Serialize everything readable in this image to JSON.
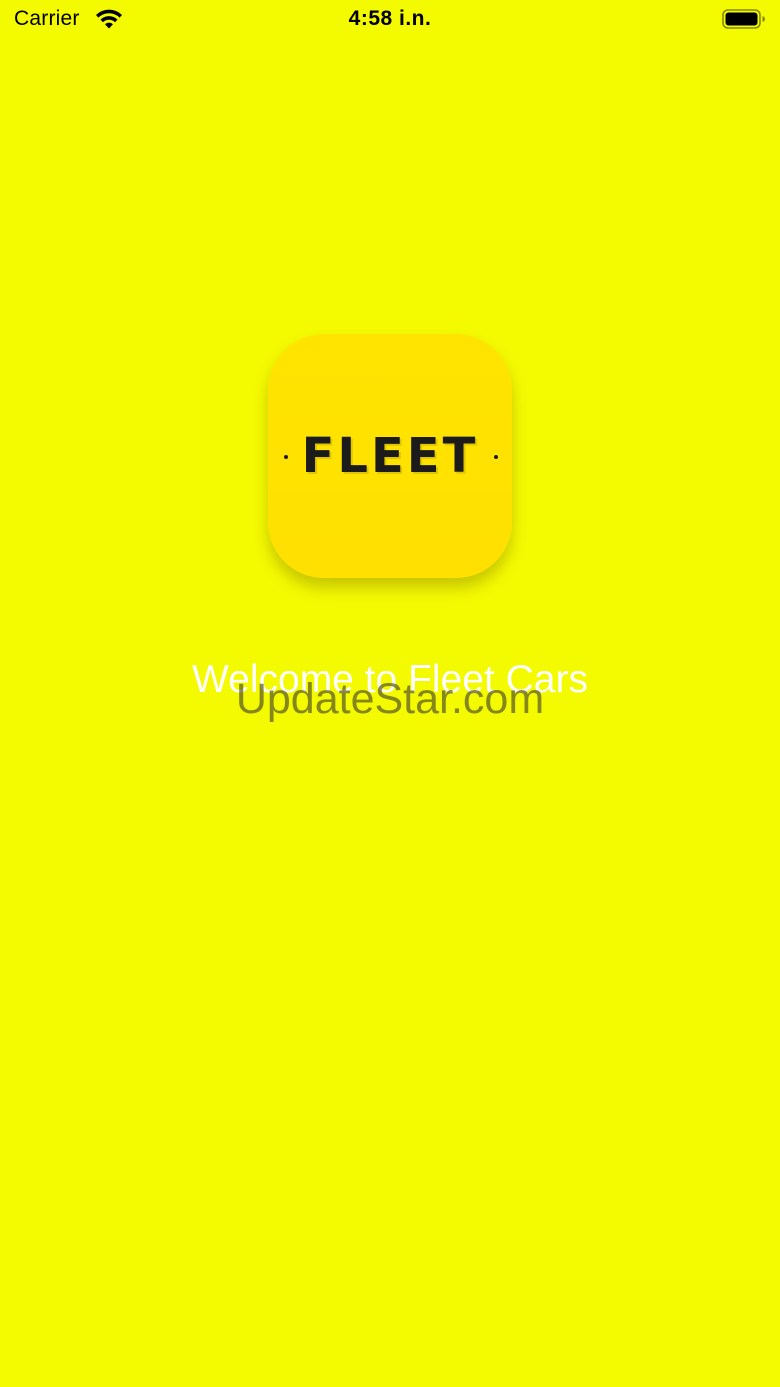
{
  "status_bar": {
    "carrier": "Carrier",
    "time": "4:58 i.n.",
    "icons": [
      "wifi-icon",
      "battery-icon"
    ]
  },
  "app_icon": {
    "logo_text": "FLEET",
    "background_color": "#ffe400",
    "text_color": "#1b1b1b"
  },
  "welcome": {
    "text": "Welcome to Fleet Cars"
  },
  "watermark": {
    "text": "UpdateStar.com"
  },
  "colors": {
    "screen_background": "#f4fa00",
    "welcome_text": "#ffffff"
  }
}
